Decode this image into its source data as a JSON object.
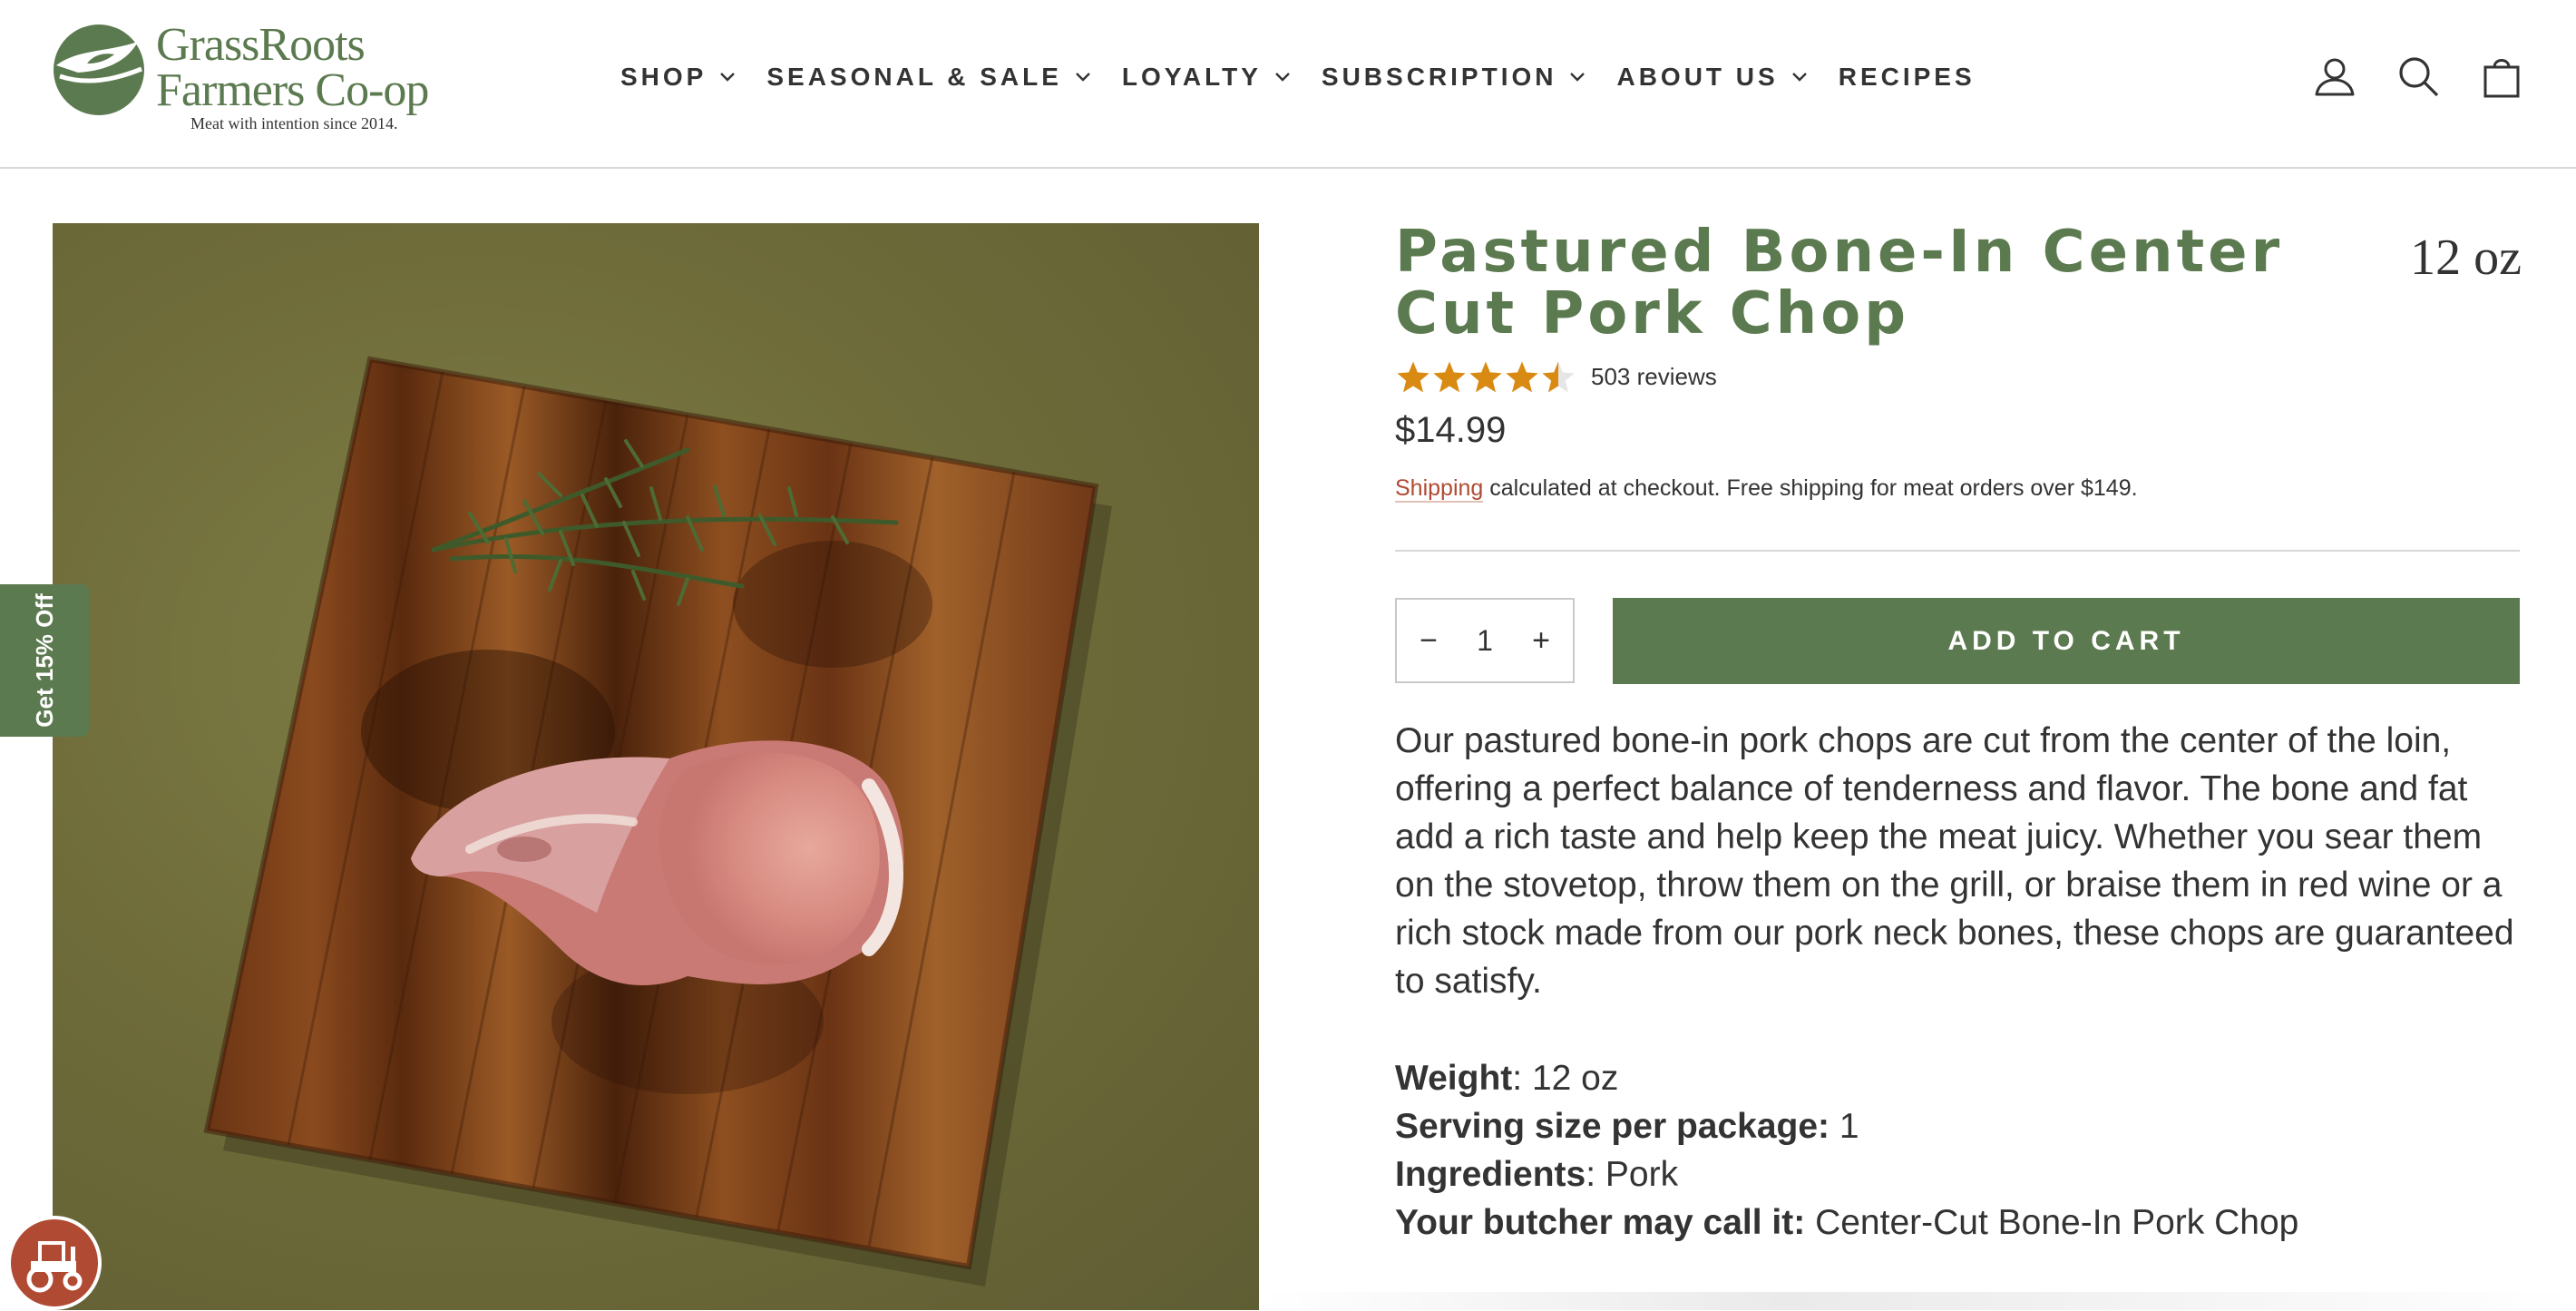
{
  "brand": {
    "name_line1": "GrassRoots",
    "name_line2": "Farmers Co-op",
    "tagline": "Meat with intention since 2014.",
    "accent_color": "#5c7a4f",
    "link_color": "#b04a32"
  },
  "nav": {
    "items": [
      {
        "label": "SHOP",
        "has_dropdown": true
      },
      {
        "label": "SEASONAL & SALE",
        "has_dropdown": true
      },
      {
        "label": "LOYALTY",
        "has_dropdown": true
      },
      {
        "label": "SUBSCRIPTION",
        "has_dropdown": true
      },
      {
        "label": "ABOUT US",
        "has_dropdown": true
      },
      {
        "label": "RECIPES",
        "has_dropdown": false
      }
    ],
    "icons": [
      "account-icon",
      "search-icon",
      "cart-icon"
    ]
  },
  "side_tab": {
    "discount_label": "Get 15% Off",
    "badge_icon": "tractor-icon"
  },
  "product": {
    "title": "Pastured Bone-In Center Cut Pork Chop",
    "weight_header": "12 oz",
    "rating": 4.5,
    "rating_max": 5,
    "reviews_label": "503 reviews",
    "price": "$14.99",
    "shipping_link": "Shipping",
    "shipping_text": " calculated at checkout. Free shipping for meat orders over $149.",
    "quantity": "1",
    "qty_minus": "−",
    "qty_plus": "+",
    "add_to_cart_label": "ADD TO CART",
    "description": "Our pastured bone-in pork chops are cut from the center of the loin, offering a perfect balance of tenderness and flavor. The bone and fat add a rich taste and help keep the meat juicy. Whether you sear them on the stovetop, throw them on the grill, or braise them in red wine or a rich stock made from our pork neck bones, these chops are guaranteed to satisfy.",
    "specs": [
      {
        "key": "Weight",
        "sep": ": ",
        "value": "12 oz"
      },
      {
        "key": "Serving size per package:",
        "sep": " ",
        "value": "1"
      },
      {
        "key": "Ingredients",
        "sep": ": ",
        "value": "Pork"
      },
      {
        "key": "Your butcher may call it:",
        "sep": " ",
        "value": "Center-Cut Bone-In Pork Chop"
      }
    ]
  }
}
